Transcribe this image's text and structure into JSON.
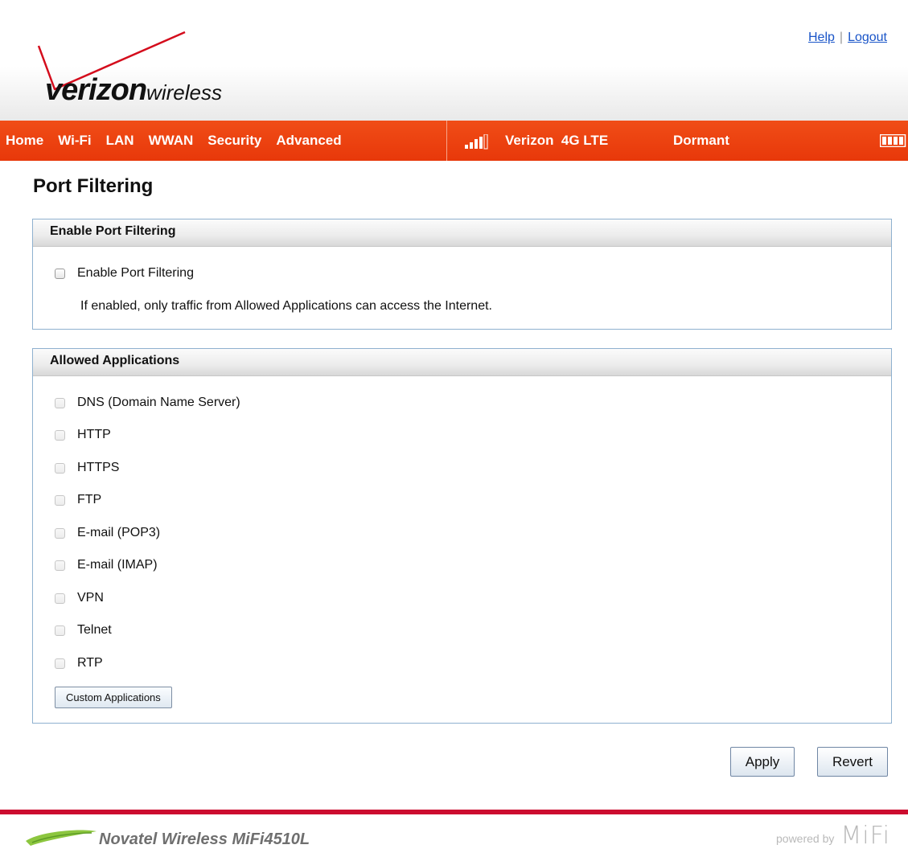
{
  "brand": {
    "logo_text_main": "verizon",
    "logo_text_sub": "wireless",
    "accent_color": "#e8380a",
    "footer_line_color": "#cc0c2f"
  },
  "top_links": {
    "help": "Help",
    "separator": "|",
    "logout": "Logout"
  },
  "nav": {
    "items": [
      "Home",
      "Wi-Fi",
      "LAN",
      "WWAN",
      "Security",
      "Advanced"
    ],
    "signal_icon": "signal-bars-icon",
    "carrier": "Verizon  4G LTE",
    "connection_state": "Dormant",
    "battery_icon": "battery-icon"
  },
  "page": {
    "title": "Port Filtering"
  },
  "enable_panel": {
    "heading": "Enable Port Filtering",
    "checkbox_label": "Enable Port Filtering",
    "checked": false,
    "hint": "If enabled, only traffic from Allowed Applications can access the Internet."
  },
  "allowed_panel": {
    "heading": "Allowed Applications",
    "apps": [
      {
        "label": "DNS (Domain Name Server)",
        "checked": false,
        "enabled": false
      },
      {
        "label": "HTTP",
        "checked": false,
        "enabled": false
      },
      {
        "label": "HTTPS",
        "checked": false,
        "enabled": false
      },
      {
        "label": "FTP",
        "checked": false,
        "enabled": false
      },
      {
        "label": "E-mail (POP3)",
        "checked": false,
        "enabled": false
      },
      {
        "label": "E-mail (IMAP)",
        "checked": false,
        "enabled": false
      },
      {
        "label": "VPN",
        "checked": false,
        "enabled": false
      },
      {
        "label": "Telnet",
        "checked": false,
        "enabled": false
      },
      {
        "label": "RTP",
        "checked": false,
        "enabled": false
      }
    ],
    "custom_button": "Custom Applications"
  },
  "actions": {
    "apply": "Apply",
    "revert": "Revert"
  },
  "footer": {
    "product": "Novatel Wireless MiFi4510L",
    "powered_by": "powered by",
    "mifi": "MiFi"
  }
}
